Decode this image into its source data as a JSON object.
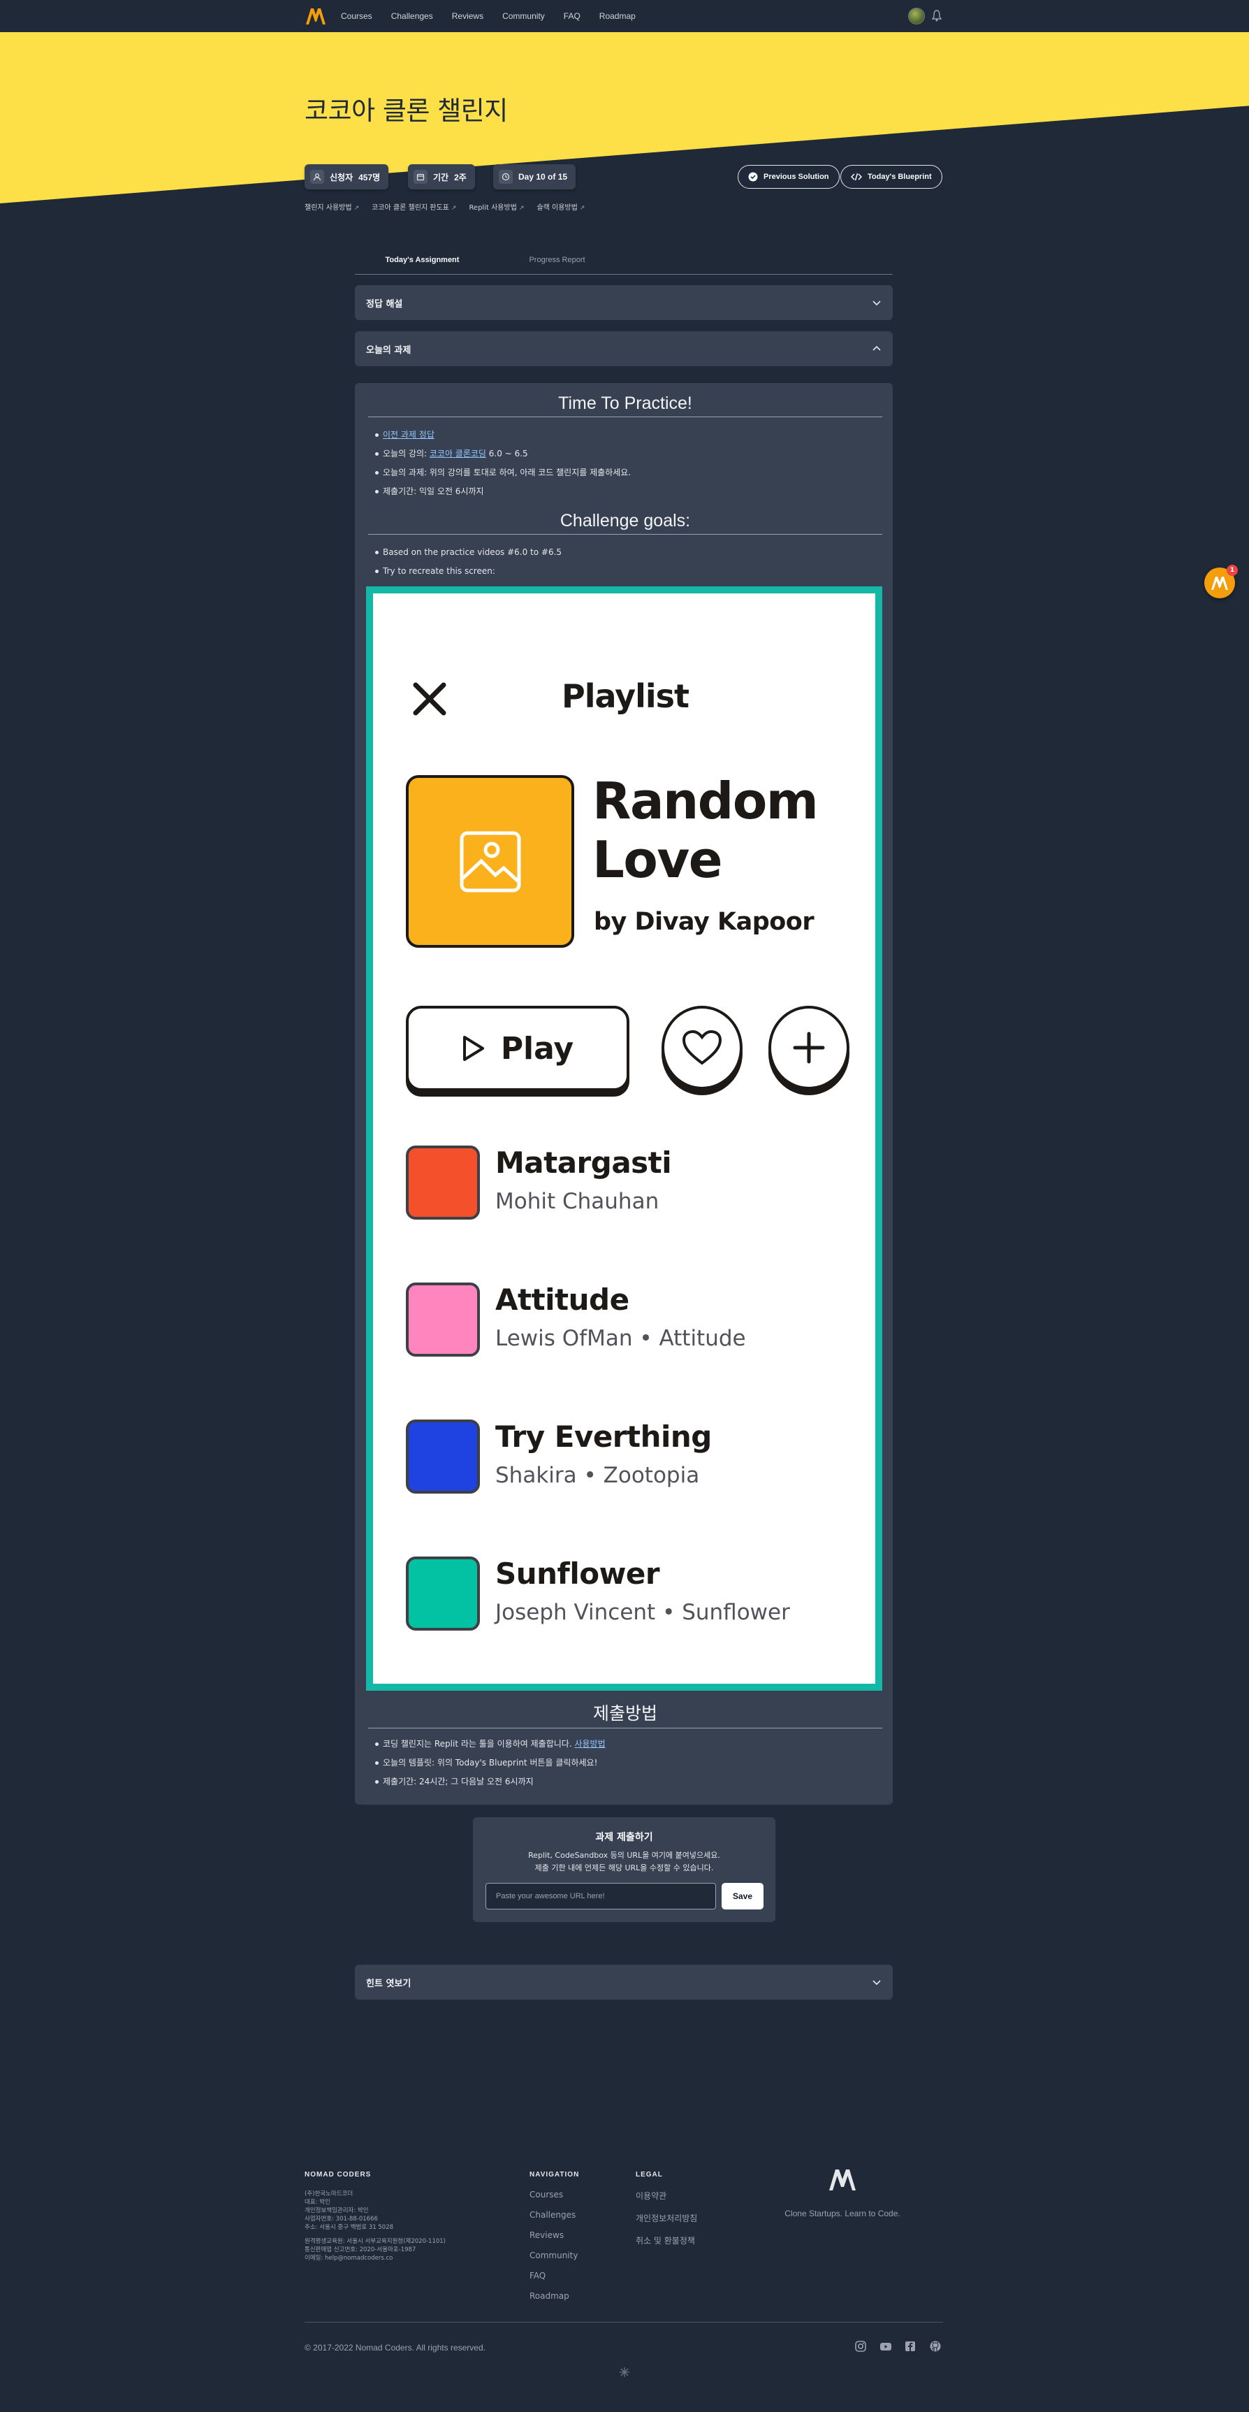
{
  "nav": {
    "links": [
      "Courses",
      "Challenges",
      "Reviews",
      "Community",
      "FAQ",
      "Roadmap"
    ],
    "logo_icon": "nomad-logo-icon",
    "avatar_icon": "avatar",
    "bell_icon": "bell-icon"
  },
  "hero": {
    "title": "코코아 클론 챌린지",
    "badges": [
      {
        "label": "신청자",
        "value": "457명",
        "icon": "users-icon"
      },
      {
        "label": "기간",
        "value": "2주",
        "icon": "calendar-icon"
      },
      {
        "label": "",
        "value": "Day 10 of 15",
        "icon": "clock-icon"
      }
    ],
    "prev_solution": "Previous Solution",
    "blueprint": "Today's Blueprint",
    "sublinks": [
      "챌린지 사용방법",
      "코코아 클론 챌린지 판도표",
      "Replit 사용방법",
      "슬랙 이용방법"
    ]
  },
  "tabs": [
    "Today's Assignment",
    "Progress Report"
  ],
  "accordions": {
    "answer": "정답 해설",
    "today": "오늘의 과제",
    "hint": "힌트 엿보기"
  },
  "practice": {
    "heading": "Time To Practice!",
    "item1_link": "이전 과제 정답",
    "item2_prefix": "오늘의 강의: ",
    "item2_link": "코코아 클론코딩",
    "item2_suffix": " 6.0 ~ 6.5",
    "item3": "오늘의 과제: 위의 강의를 토대로 하여, 아래 코드 챌린지를 제출하세요.",
    "item4": "제출기간: 익일 오전 6시까지"
  },
  "goals": {
    "heading": "Challenge goals:",
    "item1": "Based on the practice videos #6.0 to #6.5",
    "item2": "Try to recreate this screen:"
  },
  "mockup": {
    "title": "Playlist",
    "song": "Random Love",
    "song_line1": "Random",
    "song_line2": "Love",
    "artist": "by Divay Kapoor",
    "play": "Play",
    "border_color": "#14b8a6",
    "cover_color": "#fbb11b",
    "tracks": [
      {
        "name": "Matargasti",
        "artist": "Mohit Chauhan",
        "color": "#f4502b"
      },
      {
        "name": "Attitude",
        "artist": "Lewis OfMan • Attitude",
        "color": "#ff85bf"
      },
      {
        "name": "Try Everthing",
        "artist": "Shakira • Zootopia",
        "color": "#1f43e0"
      },
      {
        "name": "Sunflower",
        "artist": "Joseph Vincent • Sunflower",
        "color": "#03c1a3"
      }
    ]
  },
  "submit_method": {
    "heading": "제출방법",
    "item1_prefix": "코딩 챌린지는 Replit 라는 툴을 이용하여 제출합니다. ",
    "item1_link": "사용방법",
    "item2": "오늘의 템플릿: 위의 Today's Blueprint 버튼을 클릭하세요!",
    "item3": "제출기간: 24시간; 그 다음날 오전 6시까지"
  },
  "submit_form": {
    "title": "과제 제출하기",
    "desc1": "Replit, CodeSandbox 등의 URL을 여기에 붙여넣으세요.",
    "desc2": "제출 기한 내에 언제든 해당 URL을 수정할 수 있습니다.",
    "placeholder": "Paste your awesome URL here!",
    "save": "Save"
  },
  "footer": {
    "company_head": "NOMAD CODERS",
    "company_info": [
      "(주)한국노마드코더",
      "대표: 박인",
      "개인정보책임관리자: 박인",
      "사업자번호: 301-88-01666",
      "주소: 서울시 중구 백범로 31 5028",
      "",
      "원격평생교육원: 서울시 서부교육지원청(제2020-1101)",
      "통신판매업 신고번호: 2020-서울마포-1987",
      "이메일: help@nomadcoders.co"
    ],
    "nav_head": "NAVIGATION",
    "nav_links": [
      "Courses",
      "Challenges",
      "Reviews",
      "Community",
      "FAQ",
      "Roadmap"
    ],
    "legal_head": "LEGAL",
    "legal_links": [
      "이용약관",
      "개인정보처리방침",
      "취소 및 환불정책"
    ],
    "tagline": "Clone Startups. Learn to Code.",
    "copyright": "© 2017-2022 Nomad Coders. All rights reserved.",
    "social_icons": [
      "instagram-icon",
      "youtube-icon",
      "facebook-icon",
      "github-icon"
    ]
  },
  "chat_count": "1"
}
